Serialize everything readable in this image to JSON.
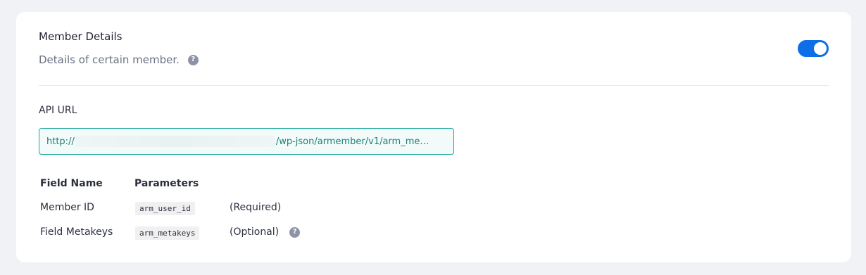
{
  "header": {
    "title": "Member Details",
    "subtitle": "Details of certain member.",
    "help_icon": "question-circle-icon",
    "toggle_on": true,
    "accent_color": "#0d6fe8"
  },
  "api": {
    "label": "API URL",
    "url_prefix": "http://",
    "url_suffix": "/wp-json/armember/v1/arm_me…"
  },
  "fields_table": {
    "headers": [
      "Field Name",
      "Parameters"
    ],
    "rows": [
      {
        "name": "Member ID",
        "param": "arm_user_id",
        "note": "(Required)"
      },
      {
        "name": "Field Metakeys",
        "param": "arm_metakeys",
        "note": "(Optional)"
      }
    ]
  }
}
